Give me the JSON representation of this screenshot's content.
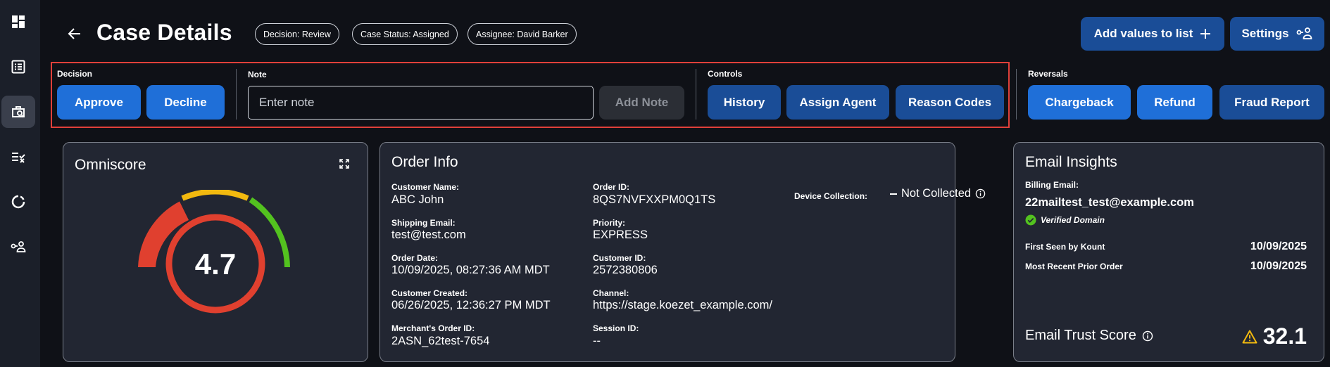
{
  "header": {
    "title": "Case Details",
    "pills": [
      "Decision: Review",
      "Case Status: Assigned",
      "Assignee: David Barker"
    ],
    "add_values_label": "Add values to list",
    "settings_label": "Settings"
  },
  "sidebar": {
    "items": [
      {
        "icon": "dashboard-icon"
      },
      {
        "icon": "list-icon"
      },
      {
        "icon": "case-search-icon",
        "active": true
      },
      {
        "icon": "rules-icon"
      },
      {
        "icon": "loading-icon"
      },
      {
        "icon": "user-key-icon"
      }
    ]
  },
  "actions": {
    "decision_label": "Decision",
    "approve": "Approve",
    "decline": "Decline",
    "note_label": "Note",
    "note_placeholder": "Enter note",
    "note_value": "",
    "add_note": "Add Note",
    "controls_label": "Controls",
    "history": "History",
    "assign_agent": "Assign Agent",
    "reason_codes": "Reason Codes",
    "reversals_label": "Reversals",
    "chargeback": "Chargeback",
    "refund": "Refund",
    "fraud_report": "Fraud Report"
  },
  "omniscore": {
    "title": "Omniscore",
    "value": "4.7",
    "score_fraction": 0.47,
    "colors": {
      "red": "#e0402f",
      "yellow": "#f2b90f",
      "green": "#53c21f"
    }
  },
  "order_info": {
    "title": "Order Info",
    "customer_name_label": "Customer Name:",
    "customer_name": "ABC John",
    "shipping_email_label": "Shipping Email:",
    "shipping_email": "test@test.com",
    "order_date_label": "Order Date:",
    "order_date": "10/09/2025, 08:27:36 AM MDT",
    "customer_created_label": "Customer Created:",
    "customer_created": "06/26/2025, 12:36:27 PM MDT",
    "merchant_order_id_label": "Merchant's Order ID:",
    "merchant_order_id": "2ASN_62test-7654",
    "order_id_label": "Order ID:",
    "order_id": "8QS7NVFXXPM0Q1TS",
    "priority_label": "Priority:",
    "priority": "EXPRESS",
    "customer_id_label": "Customer ID:",
    "customer_id": "2572380806",
    "channel_label": "Channel:",
    "channel": "https://stage.koezet_example.com/",
    "session_id_label": "Session ID:",
    "session_id": "--",
    "device_collection_label": "Device Collection:",
    "device_collection_value": "Not Collected"
  },
  "email_insights": {
    "title": "Email Insights",
    "billing_email_label": "Billing Email:",
    "billing_email": "22mailtest_test@example.com",
    "verified_label": "Verified Domain",
    "first_seen_label": "First Seen by Kount",
    "first_seen_value": "10/09/2025",
    "recent_order_label": "Most Recent Prior Order",
    "recent_order_value": "10/09/2025",
    "trust_score_label": "Email Trust Score",
    "trust_score_value": "32.1"
  },
  "colors": {
    "background": "#0f1117",
    "sidebar": "#1b1f29",
    "card": "#222632",
    "primary_blue": "#1f6fd8",
    "dark_blue": "#1a4d97",
    "highlight_border": "#e0403a",
    "warning": "#f2b90f",
    "verified_green": "#53c21f"
  }
}
